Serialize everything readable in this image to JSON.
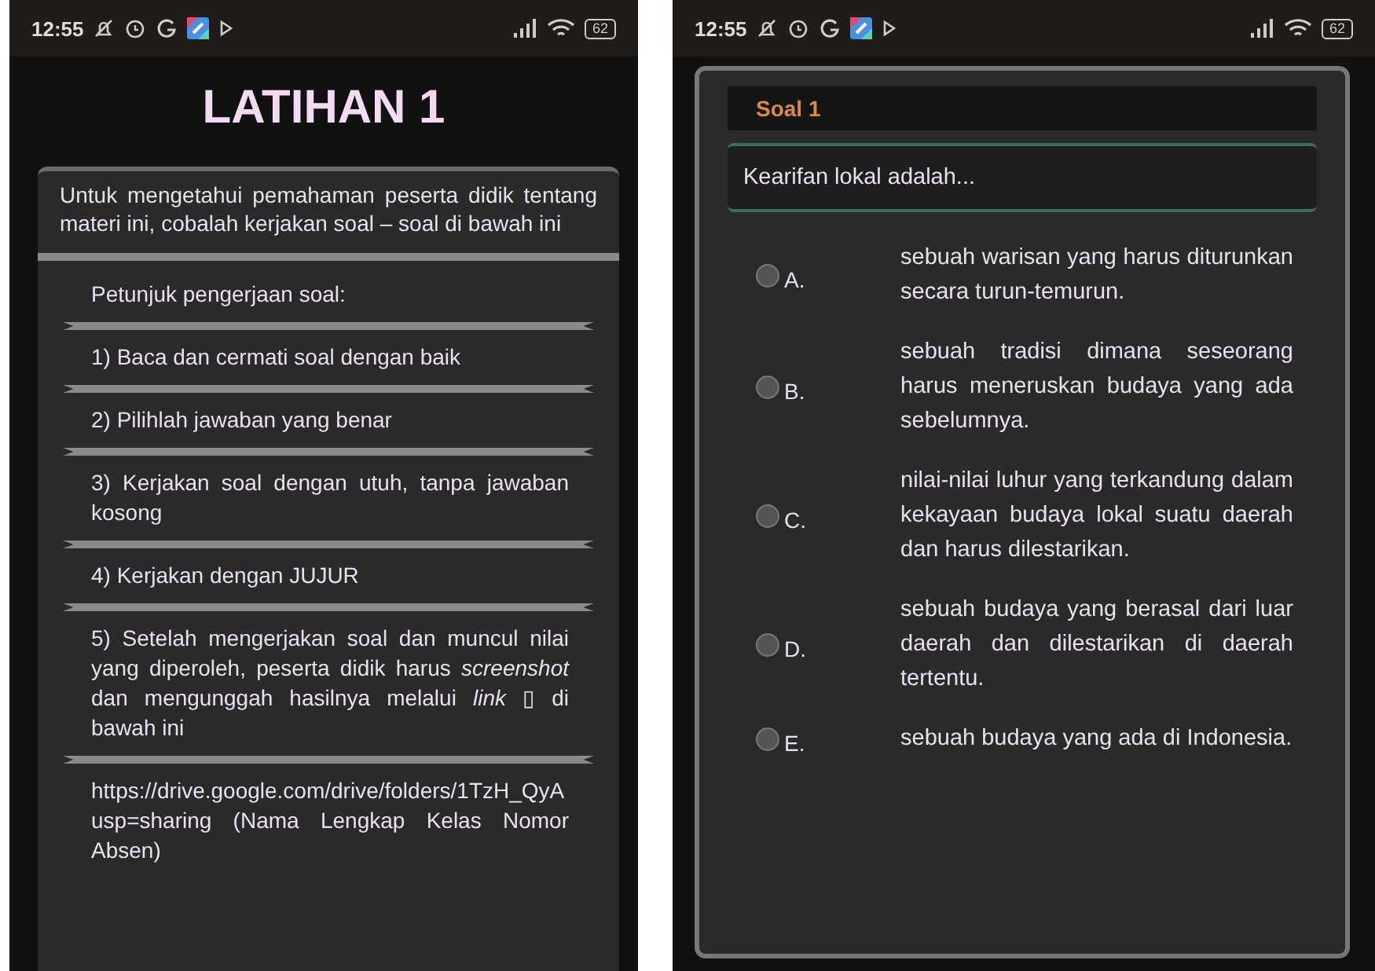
{
  "left_screen": {
    "status_bar": {
      "time": "12:55",
      "battery": "62"
    },
    "title": "LATIHAN 1",
    "intro": "Untuk mengetahui pemahaman peserta didik tentang materi ini, cobalah kerjakan soal – soal di bawah ini",
    "instructions": [
      {
        "text": "Petunjuk pengerjaan soal:"
      },
      {
        "text": "1) Baca dan cermati soal dengan baik"
      },
      {
        "text": "2) Pilihlah jawaban yang benar"
      },
      {
        "text": "3) Kerjakan soal dengan utuh, tanpa jawaban kosong"
      },
      {
        "text": "4) Kerjakan dengan JUJUR"
      },
      {
        "text": "5) Setelah mengerjakan soal dan muncul nilai yang diperoleh, peserta didik harus *screenshot* dan mengunggah hasilnya melalui *link* ▯ di bawah ini"
      }
    ],
    "link": {
      "url": "https://drive.google.com/drive/folders/1TzH_QyA",
      "rest": "usp=sharing (Nama Lengkap Kelas Nomor Absen)"
    }
  },
  "right_screen": {
    "status_bar": {
      "time": "12:55",
      "battery": "62"
    },
    "question_header": "Soal 1",
    "question": "Kearifan lokal adalah...",
    "options": [
      {
        "letter": "A.",
        "text": "sebuah warisan yang harus diturunkan secara turun-temurun.",
        "selected": false
      },
      {
        "letter": "B.",
        "text": "sebuah tradisi dimana seseorang harus meneruskan budaya yang ada sebelumnya.",
        "selected": false
      },
      {
        "letter": "C.",
        "text": "nilai-nilai luhur yang terkandung dalam kekayaan budaya lokal suatu daerah dan harus dilestarikan.",
        "selected": false
      },
      {
        "letter": "D.",
        "text": "sebuah budaya yang berasal dari luar daerah dan dilestarikan di daerah tertentu.",
        "selected": false
      },
      {
        "letter": "E.",
        "text": "sebuah budaya yang ada di Indonesia.",
        "selected": false
      }
    ]
  }
}
